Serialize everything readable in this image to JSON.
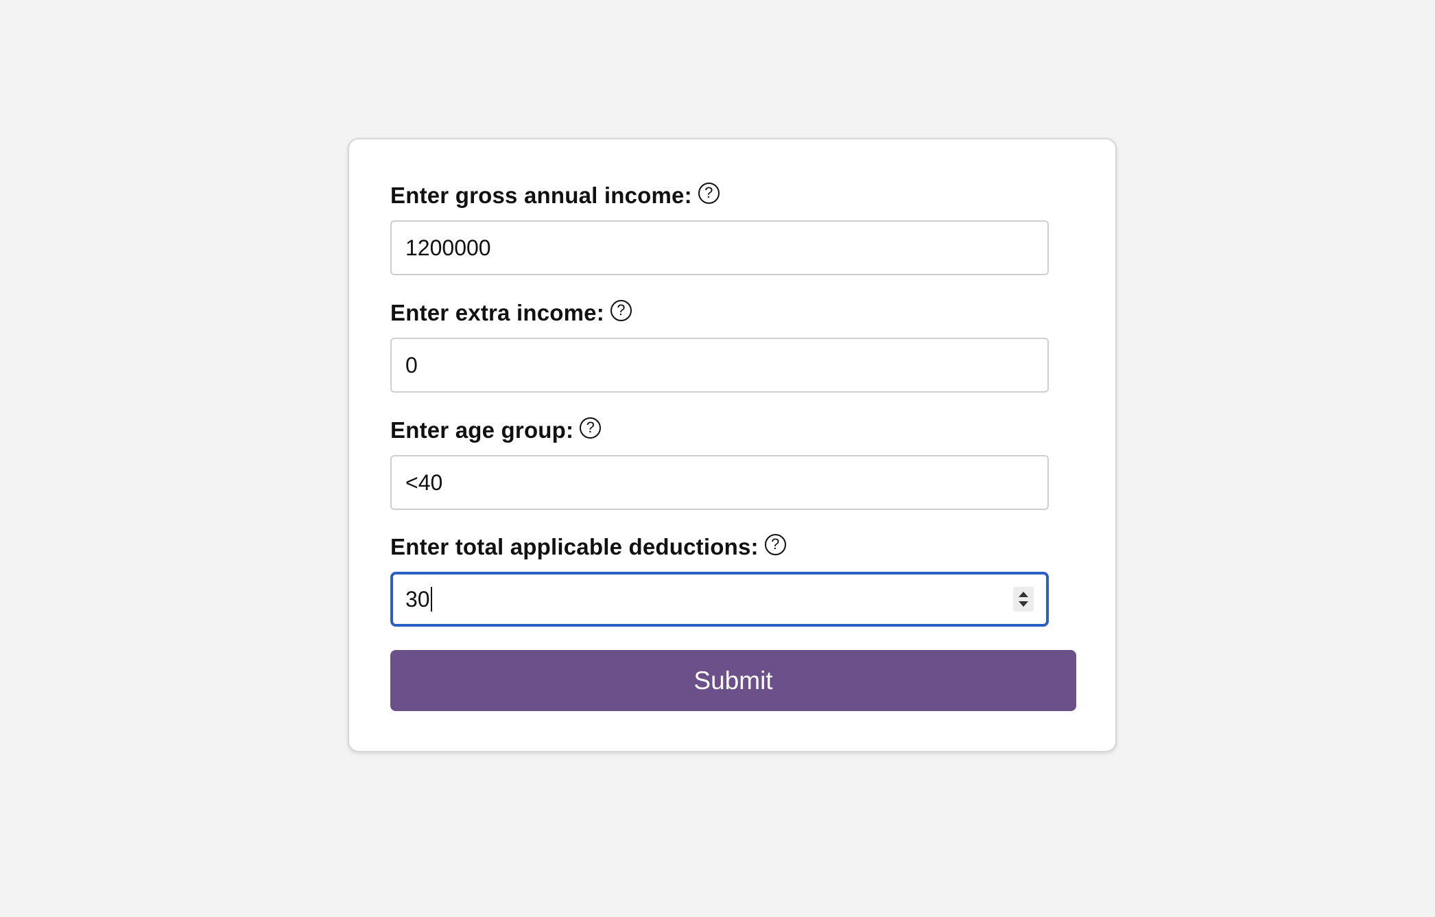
{
  "form": {
    "fields": [
      {
        "label": "Enter gross annual income:",
        "help_icon": "question-circle-icon",
        "value": "1200000"
      },
      {
        "label": "Enter extra income:",
        "help_icon": "question-circle-icon",
        "value": "0"
      },
      {
        "label": "Enter age group:",
        "help_icon": "question-circle-icon",
        "value": "<40"
      },
      {
        "label": "Enter total applicable deductions:",
        "help_icon": "question-circle-icon",
        "value": "30",
        "focused": true,
        "type": "number"
      }
    ],
    "help_glyph": "?",
    "submit_label": "Submit"
  },
  "colors": {
    "background": "#f3f3f3",
    "card": "#ffffff",
    "submit_button": "#6b5089",
    "focus_border": "#2b5fc4"
  }
}
